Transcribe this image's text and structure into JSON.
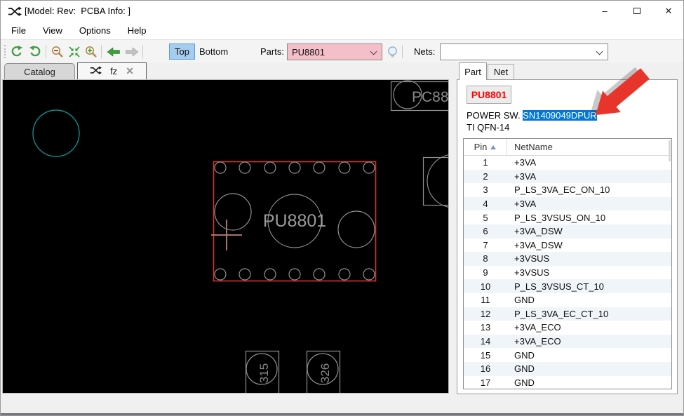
{
  "window": {
    "title": "[Model: Rev:  PCBA Info: ]",
    "controls": {
      "minimize": "–",
      "close": "✕"
    }
  },
  "menu": {
    "items": [
      "File",
      "View",
      "Options",
      "Help"
    ]
  },
  "toolbar": {
    "view_top": "Top",
    "view_bottom": "Bottom",
    "parts_label": "Parts:",
    "parts_value": "PU8801",
    "nets_label": "Nets:",
    "nets_value": ""
  },
  "left_tabs": {
    "catalog_label": "Catalog",
    "active_label": "fz",
    "close_glyph": "✕"
  },
  "canvas": {
    "selected_part_ref": "PU8801",
    "neighbor_ref": "PC88",
    "bottom_ref_1": "315",
    "bottom_ref_2": "326",
    "colors": {
      "background": "#000000",
      "outline_gray": "#909090",
      "selected_red": "#D23430",
      "teal": "#0E8C8C",
      "cross": "#A87070"
    }
  },
  "panel": {
    "tab_part": "Part",
    "tab_net": "Net",
    "part_button_label": "PU8801",
    "description": {
      "prefix": "POWER SW. ",
      "highlighted": "SN1409049DPUR",
      "line2": "TI QFN-14"
    },
    "table": {
      "columns": [
        "Pin",
        "NetName"
      ],
      "rows": [
        [
          1,
          "+3VA"
        ],
        [
          2,
          "+3VA"
        ],
        [
          3,
          "P_LS_3VA_EC_ON_10"
        ],
        [
          4,
          "+3VA"
        ],
        [
          5,
          "P_LS_3VSUS_ON_10"
        ],
        [
          6,
          "+3VA_DSW"
        ],
        [
          7,
          "+3VA_DSW"
        ],
        [
          8,
          "+3VSUS"
        ],
        [
          9,
          "+3VSUS"
        ],
        [
          10,
          "P_LS_3VSUS_CT_10"
        ],
        [
          11,
          "GND"
        ],
        [
          12,
          "P_LS_3VA_EC_CT_10"
        ],
        [
          13,
          "+3VA_ECO"
        ],
        [
          14,
          "+3VA_ECO"
        ],
        [
          15,
          "GND"
        ],
        [
          16,
          "GND"
        ],
        [
          17,
          "GND"
        ]
      ]
    },
    "colors": {
      "selection_blue": "#0078D7",
      "part_text_red": "#FF0000",
      "row_stripe": "#F0F5FA",
      "arrow_red": "#E8352C"
    }
  }
}
